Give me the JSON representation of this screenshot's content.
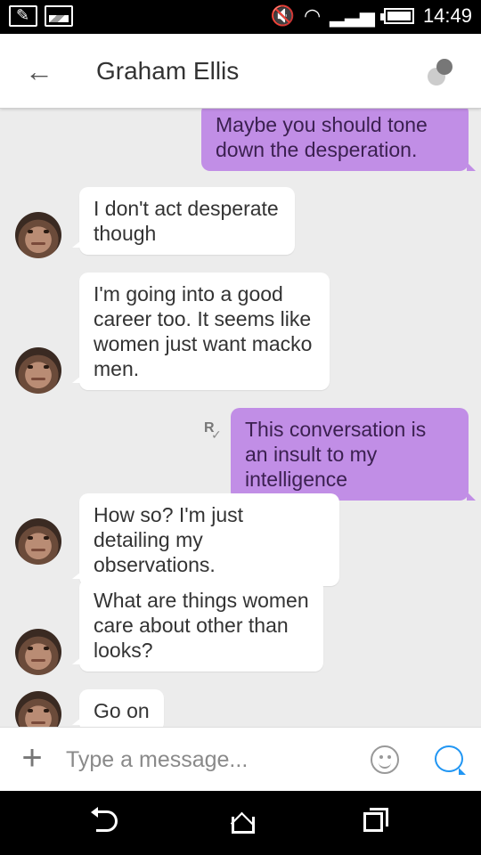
{
  "status_bar": {
    "time": "14:49",
    "icons": [
      "notes-icon",
      "image-icon",
      "mute-icon",
      "wifi-icon",
      "signal-icon",
      "battery-icon"
    ]
  },
  "header": {
    "contact_name": "Graham Ellis",
    "back_icon": "arrow-left-icon",
    "menu_icon": "overflow-menu-icon"
  },
  "messages": [
    {
      "from": "me",
      "text": "Maybe you should tone down the desperation."
    },
    {
      "from": "contact",
      "text": "I don't act desperate though"
    },
    {
      "from": "contact",
      "text": "I'm going into a good career too. It seems like women just want macko men."
    },
    {
      "from": "me",
      "text": "This conversation is an insult to my intelligence",
      "receipt": "R"
    },
    {
      "from": "contact",
      "text": "How so? I'm just detailing my observations."
    },
    {
      "from": "contact",
      "text": "What are things women care about other than looks?"
    },
    {
      "from": "contact",
      "text": "Go on"
    }
  ],
  "composer": {
    "placeholder": "Type a message...",
    "add_icon": "plus-icon",
    "emoji_icon": "smiley-icon",
    "send_icon": "chat-bubble-icon"
  },
  "colors": {
    "outgoing_bubble": "#c18ee6",
    "incoming_bubble": "#ffffff",
    "background": "#ececec",
    "accent": "#2196f3"
  }
}
